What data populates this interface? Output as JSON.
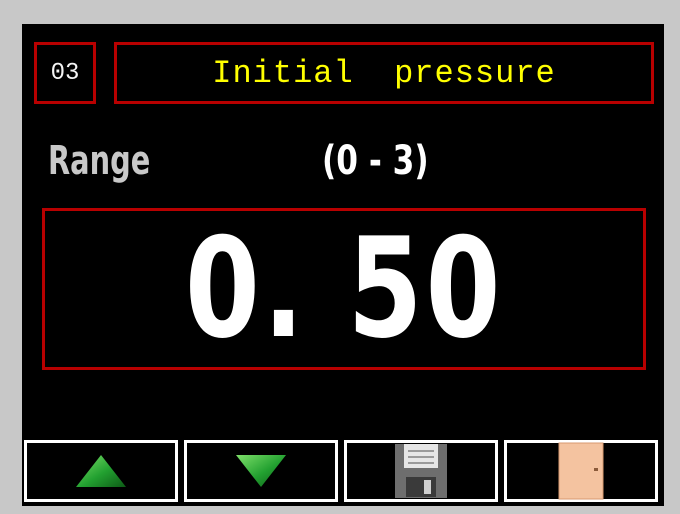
{
  "parameter": {
    "number": "03",
    "title": "Initial  pressure"
  },
  "range": {
    "label": "Range",
    "value": "(0 - 3)"
  },
  "current_value": "0. 50",
  "buttons": [
    {
      "icon": "increase-triangle-icon",
      "color": "#22a030"
    },
    {
      "icon": "decrease-triangle-icon",
      "color": "#22a030"
    },
    {
      "icon": "save-floppy-icon"
    },
    {
      "icon": "exit-door-icon",
      "color": "#f4c3a0"
    }
  ],
  "colors": {
    "frame_red": "#b80000",
    "title_yellow": "#ffff00",
    "background": "#000000"
  }
}
